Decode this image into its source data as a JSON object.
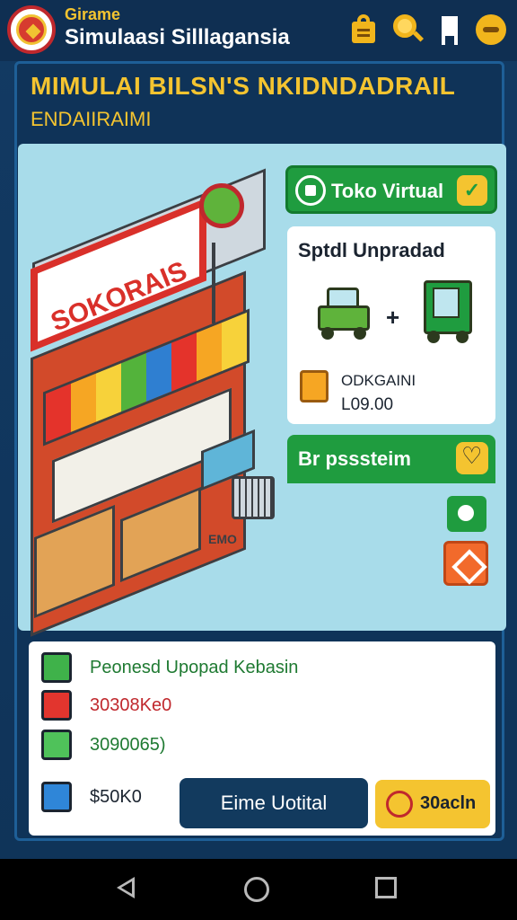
{
  "app": {
    "subtitle": "Girame",
    "title": "Simulaasi Silllagansia"
  },
  "toolbar": {
    "icons": [
      "shopping-bag-icon",
      "search-icon",
      "flag-icon",
      "smiley-icon"
    ]
  },
  "header": {
    "headline": "MIMULAI BILSN'S NKIDNDADRAIL",
    "subline": "ENDAIIRAIMI"
  },
  "scene": {
    "store_sign": "SOKORAIS",
    "caption": "EMO"
  },
  "shop_card": {
    "label": "Toko Virtual"
  },
  "upgrade_card": {
    "title": "Sptdl Unpradad",
    "plus": "+",
    "price_label": "ODKGAINI",
    "price_value": "L09.00"
  },
  "bp_card": {
    "title": "Br psssteim"
  },
  "list": {
    "rows": [
      {
        "text": "Peonesd Upopad Kebasin",
        "color": "#1f7a32"
      },
      {
        "text": "30308Ke0",
        "color": "#c0282d"
      },
      {
        "text": "3090065)",
        "color": "#1f7a32"
      },
      {
        "text": "$50K0",
        "color": "#1b2430"
      }
    ],
    "primary_button": "Eime Uotital",
    "secondary_button": "30acln"
  },
  "colors": {
    "accent_yellow": "#f4c430",
    "green": "#1f9c3f",
    "red": "#d9302a",
    "navy": "#0f3358"
  }
}
